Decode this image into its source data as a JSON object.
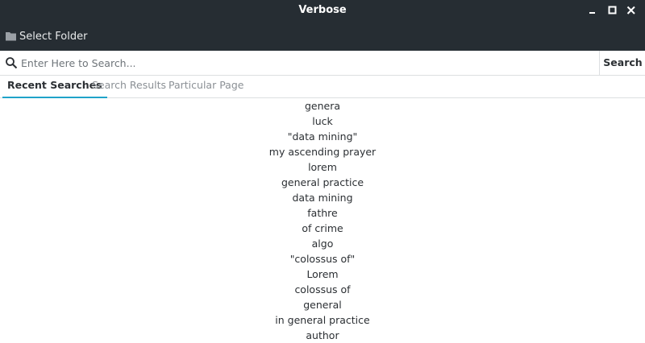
{
  "window": {
    "title": "Verbose"
  },
  "toolbar": {
    "select_folder_label": "Select Folder"
  },
  "search": {
    "placeholder": "Enter Here to Search...",
    "value": "",
    "button_label": "Search"
  },
  "tabs": [
    {
      "label": "Recent Searches",
      "active": true
    },
    {
      "label": "Search Results",
      "active": false
    },
    {
      "label": "Particular Page",
      "active": false
    }
  ],
  "recent_searches": [
    "genera",
    "luck",
    "\"data mining\"",
    "my ascending prayer",
    "lorem",
    "general practice",
    "data mining",
    "fathre",
    "of crime",
    "algo",
    "\"colossus of\"",
    "Lorem",
    "colossus of",
    "general",
    "in general practice",
    "author"
  ],
  "colors": {
    "titlebar_bg": "#262d33",
    "accent": "#1fa3c9"
  },
  "icons": {
    "folder": "folder-icon",
    "search": "search-icon",
    "minimize": "minimize-icon",
    "maximize": "maximize-icon",
    "close": "close-icon"
  }
}
